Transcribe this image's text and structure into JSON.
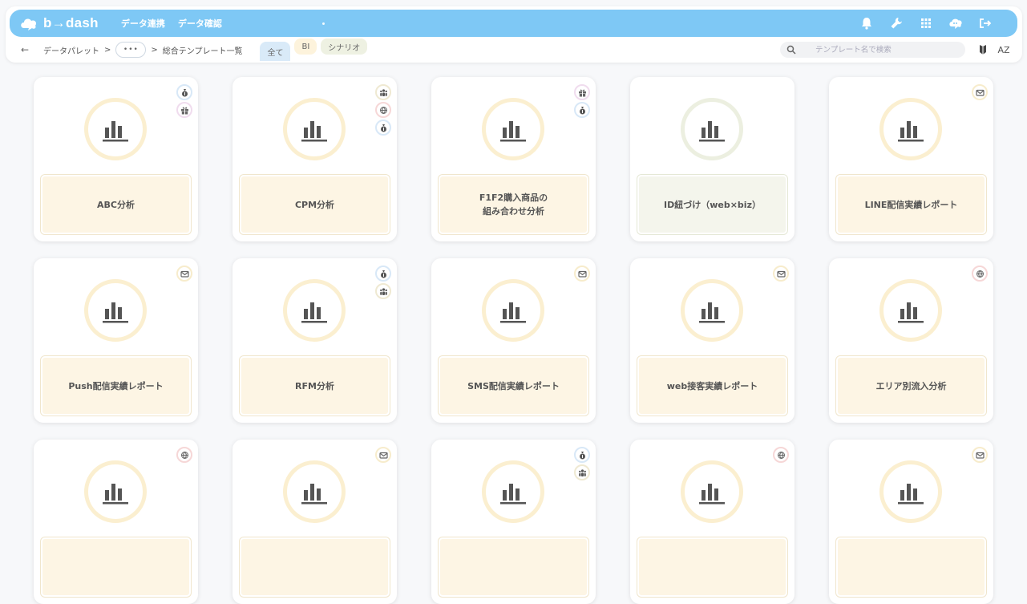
{
  "app": {
    "logo_text": "b→dash",
    "nav": [
      {
        "label": "データ連携"
      },
      {
        "label": "データ確認"
      }
    ],
    "top_icons": [
      "bell-icon",
      "wrench-icon",
      "apps-grid-icon",
      "chat-icon",
      "logout-icon"
    ]
  },
  "subbar": {
    "back_icon": "arrow-left-icon",
    "breadcrumb_root": "データパレット",
    "ellipsis": "•••",
    "breadcrumb_current": "総合テンプレート一覧",
    "separator": ">",
    "filters": [
      {
        "label": "全て",
        "active": true
      },
      {
        "label": "BI",
        "active": false
      },
      {
        "label": "シナリオ",
        "active": false
      }
    ],
    "search_placeholder": "テンプレート名で検索",
    "sort_label": "AZ"
  },
  "colors": {
    "topbar": "#7ec8f5",
    "ring_bi": "#fbefd0",
    "label_bi": "#fdf5e4",
    "ring_green": "#ecefe0",
    "label_green": "#f4f5ec",
    "chart_icon": "#555555"
  },
  "cards": [
    {
      "title": "ABC分析",
      "badges": [
        "money",
        "gift"
      ],
      "theme": "bi"
    },
    {
      "title": "CPM分析",
      "badges": [
        "people",
        "web",
        "money"
      ],
      "theme": "bi"
    },
    {
      "title": "F1F2購入商品の\n組み合わせ分析",
      "badges": [
        "gift",
        "money"
      ],
      "theme": "bi"
    },
    {
      "title": "ID紐づけ（web×biz）",
      "badges": [],
      "theme": "green"
    },
    {
      "title": "LINE配信実績レポート",
      "badges": [
        "mail"
      ],
      "theme": "bi"
    },
    {
      "title": "Push配信実績レポート",
      "badges": [
        "mail"
      ],
      "theme": "bi"
    },
    {
      "title": "RFM分析",
      "badges": [
        "money",
        "people"
      ],
      "theme": "bi"
    },
    {
      "title": "SMS配信実績レポート",
      "badges": [
        "mail"
      ],
      "theme": "bi"
    },
    {
      "title": "web接客実績レポート",
      "badges": [
        "mail"
      ],
      "theme": "bi"
    },
    {
      "title": "エリア別流入分析",
      "badges": [
        "web"
      ],
      "theme": "bi"
    },
    {
      "title": "",
      "badges": [
        "web"
      ],
      "theme": "bi"
    },
    {
      "title": "",
      "badges": [
        "mail"
      ],
      "theme": "bi"
    },
    {
      "title": "",
      "badges": [
        "money",
        "people"
      ],
      "theme": "bi"
    },
    {
      "title": "",
      "badges": [
        "web"
      ],
      "theme": "bi"
    },
    {
      "title": "",
      "badges": [
        "mail"
      ],
      "theme": "bi"
    }
  ]
}
